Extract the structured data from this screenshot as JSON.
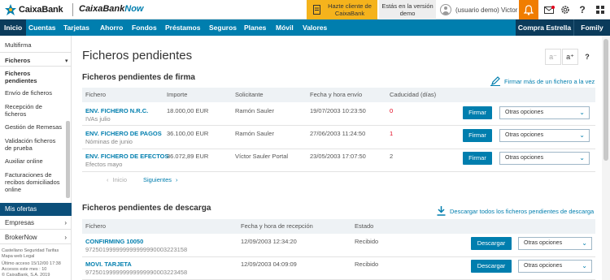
{
  "brand": {
    "logo_text": "CaixaBank",
    "product_prefix": "CaixaBank",
    "product_suffix": "Now",
    "accent": "#007eae",
    "dark": "#0b3b5b"
  },
  "top": {
    "promo_text": "Hazte cliente de CaixaBank",
    "demo_text": "Estás en la versión demo",
    "user_name": "(usuario demo) Victor",
    "icons": [
      "bell-icon",
      "mail-icon",
      "settings-icon",
      "help-icon",
      "grid-icon"
    ]
  },
  "nav": {
    "items": [
      "Inicio",
      "Cuentas",
      "Tarjetas",
      "Ahorro",
      "Fondos",
      "Préstamos",
      "Seguros",
      "Planes",
      "Móvil",
      "Valores"
    ],
    "active": "Inicio",
    "compra": "Compra Estrella",
    "fomily": "Fomily"
  },
  "sidebar": {
    "multifirma": "Multifirma",
    "section": "Ficheros",
    "items": [
      "Ficheros pendientes",
      "Envío de ficheros",
      "Recepción de ficheros",
      "Gestión de Remesas",
      "Validación ficheros de prueba",
      "Auxiliar online",
      "Facturaciones de recibos domiciliados online"
    ],
    "offers": "Mis ofertas",
    "rows": [
      "Empresas",
      "BrokerNow"
    ],
    "footer_links": "Castellano  Seguridad  Tarifas  Mapa web  Legal",
    "last_access": "Último acceso 15/12/00 17:38",
    "access_count": "Accesos este mes : 10",
    "copyright": "© CaixaBank, S.A. 2019"
  },
  "main": {
    "title": "Ficheros pendientes",
    "toolbar": [
      "a⁻",
      "a⁺",
      "?"
    ],
    "sign": {
      "title": "Ficheros pendientes de firma",
      "action": "Firmar más de un fichero a la vez",
      "headers": [
        "Fichero",
        "Importe",
        "Solicitante",
        "Fecha y hora envío",
        "Caducidad (días)"
      ],
      "rows": [
        {
          "name": "ENV. FICHERO N.R.C.",
          "desc": "IVAs julio",
          "amount": "18.000,00 EUR",
          "requester": "Ramón Sauler",
          "date": "19/07/2003 10:23:50",
          "expiry": "0"
        },
        {
          "name": "ENV. FICHERO DE PAGOS",
          "desc": "Nóminas de junio",
          "amount": "36.100,00 EUR",
          "requester": "Ramón Sauler",
          "date": "27/06/2003 11:24:50",
          "expiry": "1"
        },
        {
          "name": "ENV. FICHERO DE EFECTOS",
          "desc": "Efectos mayo",
          "amount": "36.072,89 EUR",
          "requester": "Víctor Sauler Portal",
          "date": "23/05/2003 17:07:50",
          "expiry": "2"
        }
      ],
      "button": "Firmar",
      "options": "Otras opciones",
      "prev": "Inicio",
      "next": "Siguientes"
    },
    "download": {
      "title": "Ficheros pendientes de descarga",
      "action": "Descargar todos los ficheros pendientes de descarga",
      "headers": [
        "Fichero",
        "Fecha y hora de recepción",
        "Estado"
      ],
      "rows": [
        {
          "name": "CONFIRMING 10050",
          "code": "972501999999999999990003223158",
          "date": "12/09/2003 12:34:20",
          "state": "Recibido"
        },
        {
          "name": "MOVI. TARJETA",
          "code": "972501999999999999990003223458",
          "date": "12/09/2003 04:09:09",
          "state": "Recibido"
        }
      ],
      "button": "Descargar",
      "options": "Otras opciones"
    }
  }
}
